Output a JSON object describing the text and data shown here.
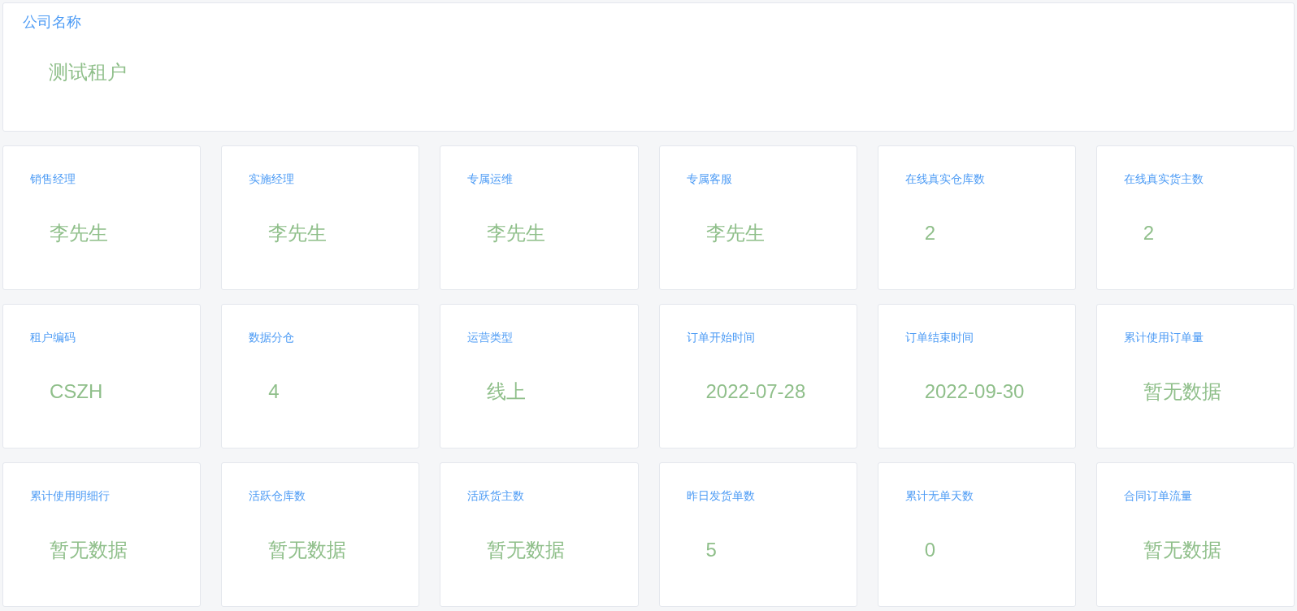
{
  "company": {
    "label": "公司名称",
    "value": "测试租户"
  },
  "cards": [
    {
      "label": "销售经理",
      "value": "李先生"
    },
    {
      "label": "实施经理",
      "value": "李先生"
    },
    {
      "label": "专属运维",
      "value": "李先生"
    },
    {
      "label": "专属客服",
      "value": "李先生"
    },
    {
      "label": "在线真实仓库数",
      "value": "2"
    },
    {
      "label": "在线真实货主数",
      "value": "2"
    },
    {
      "label": "租户编码",
      "value": "CSZH"
    },
    {
      "label": "数据分仓",
      "value": "4"
    },
    {
      "label": "运营类型",
      "value": "线上"
    },
    {
      "label": "订单开始时间",
      "value": "2022-07-28"
    },
    {
      "label": "订单结束时间",
      "value": "2022-09-30"
    },
    {
      "label": "累计使用订单量",
      "value": "暂无数据"
    },
    {
      "label": "累计使用明细行",
      "value": "暂无数据"
    },
    {
      "label": "活跃仓库数",
      "value": "暂无数据"
    },
    {
      "label": "活跃货主数",
      "value": "暂无数据"
    },
    {
      "label": "昨日发货单数",
      "value": "5"
    },
    {
      "label": "累计无单天数",
      "value": "0"
    },
    {
      "label": "合同订单流量",
      "value": "暂无数据"
    }
  ]
}
